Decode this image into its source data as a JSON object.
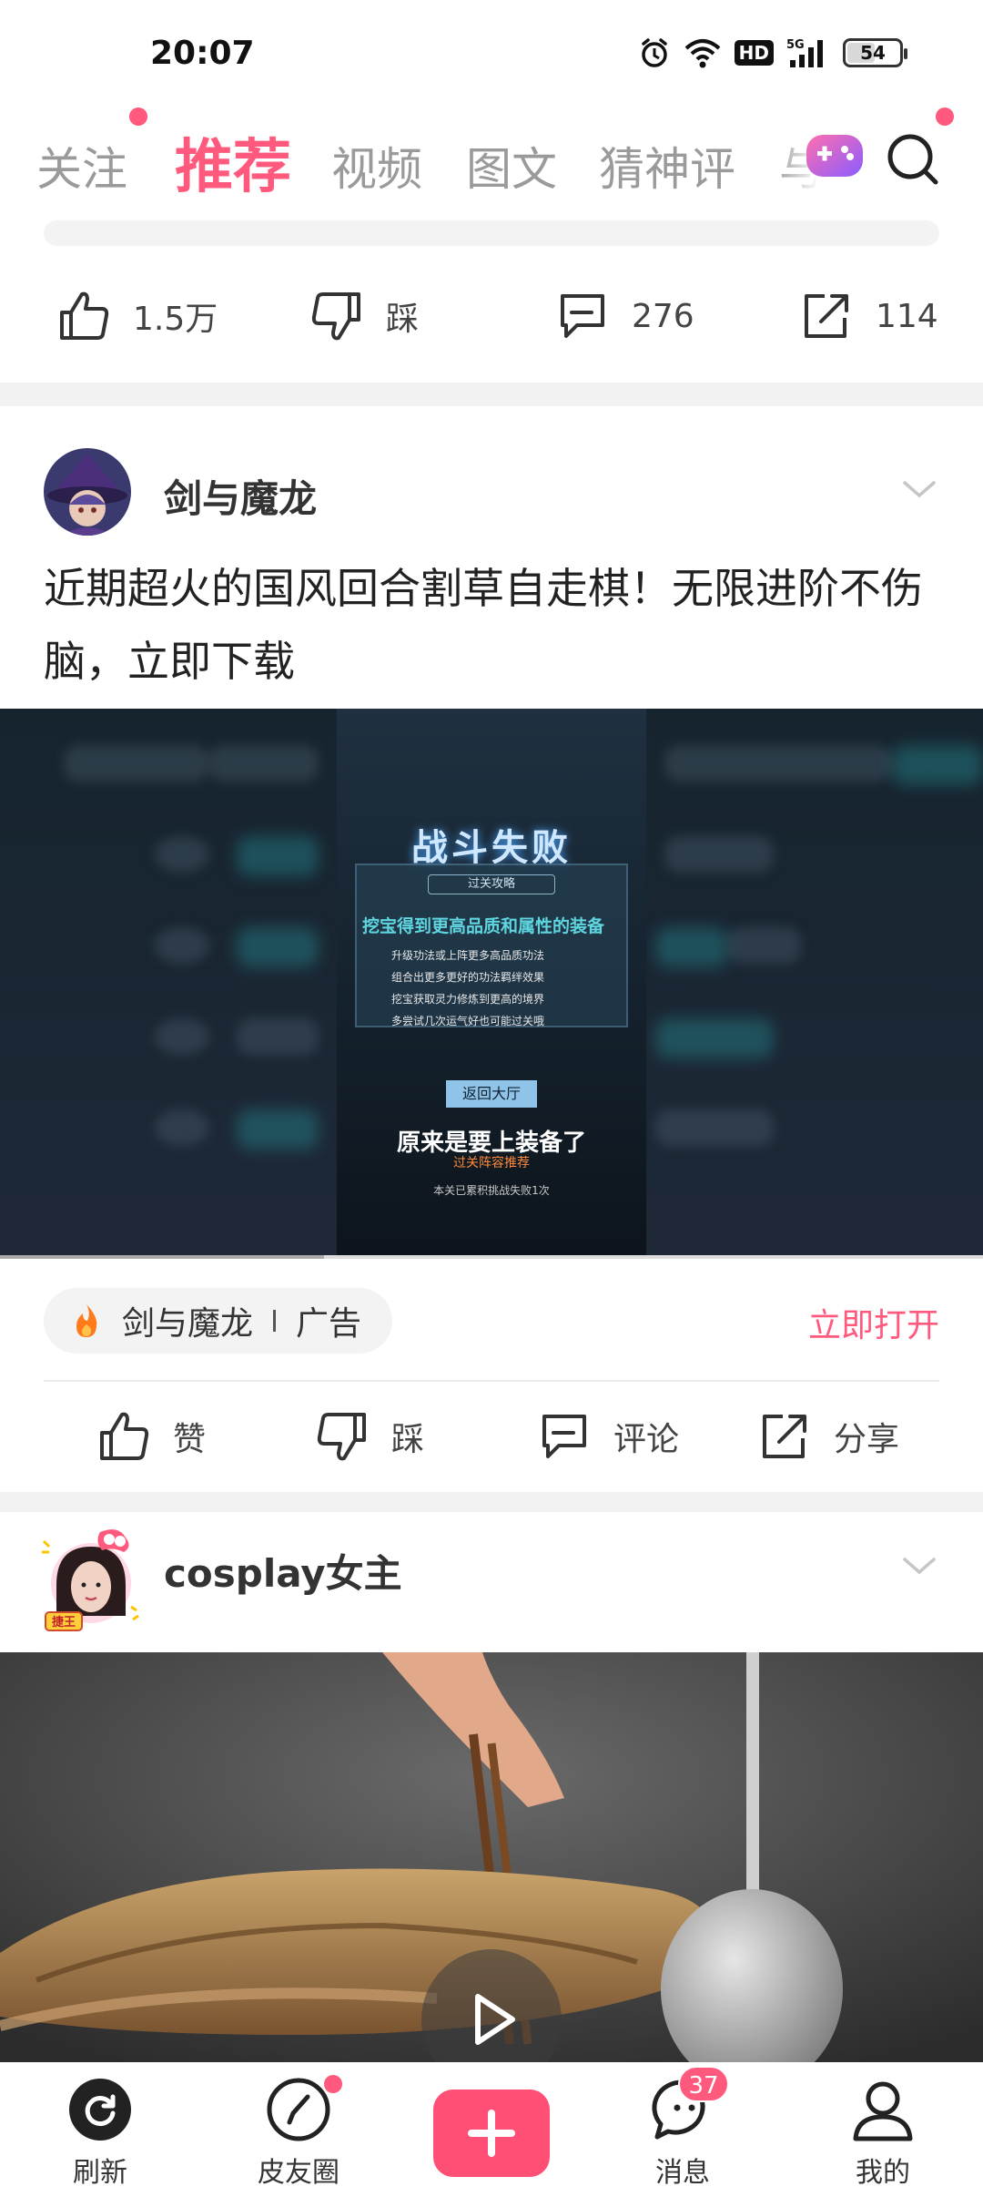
{
  "status_bar": {
    "time": "20:07",
    "hd": "HD",
    "network": "5G",
    "battery": "54",
    "battery_level": 0.54
  },
  "tabs": {
    "items": [
      "关注",
      "推荐",
      "视频",
      "图文",
      "猜神评",
      "与"
    ],
    "active": "推荐"
  },
  "post1": {
    "like_count": "1.5万",
    "dislike_label": "踩",
    "comment_count": "276",
    "share_count": "114"
  },
  "ad_post": {
    "author": "剑与魔龙",
    "title": "近期超火的国风回合割草自走棋！无限进阶不伤脑，立即下载",
    "media": {
      "game_title": "战斗失败",
      "subhead": "过关攻略",
      "main_tip": "挖宝得到更高品质和属性的装备",
      "tips": [
        "升级功法或上阵更多高品质功法",
        "组合出更多更好的功法羁绊效果",
        "挖宝获取灵力修炼到更高的境界",
        "多尝试几次运气好也可能过关哦"
      ],
      "return_button": "返回大厅",
      "caption": "原来是要上装备了",
      "caption_sub": "过关阵容推荐",
      "note": "本关已累积挑战失败1次",
      "progress": 0.33
    },
    "source_name": "剑与魔龙",
    "source_tag": "广告",
    "open_label": "立即打开",
    "actions": {
      "like": "赞",
      "dislike": "踩",
      "comment": "评论",
      "share": "分享"
    }
  },
  "cosplay_post": {
    "author": "cosplay女主",
    "avatar_badge": "捷王"
  },
  "bottom_nav": {
    "refresh": "刷新",
    "circle": "皮友圈",
    "messages": "消息",
    "messages_badge": "37",
    "mine": "我的"
  },
  "colors": {
    "accent": "#ff5a7e",
    "text": "#222222",
    "muted": "#9a9a9a"
  }
}
